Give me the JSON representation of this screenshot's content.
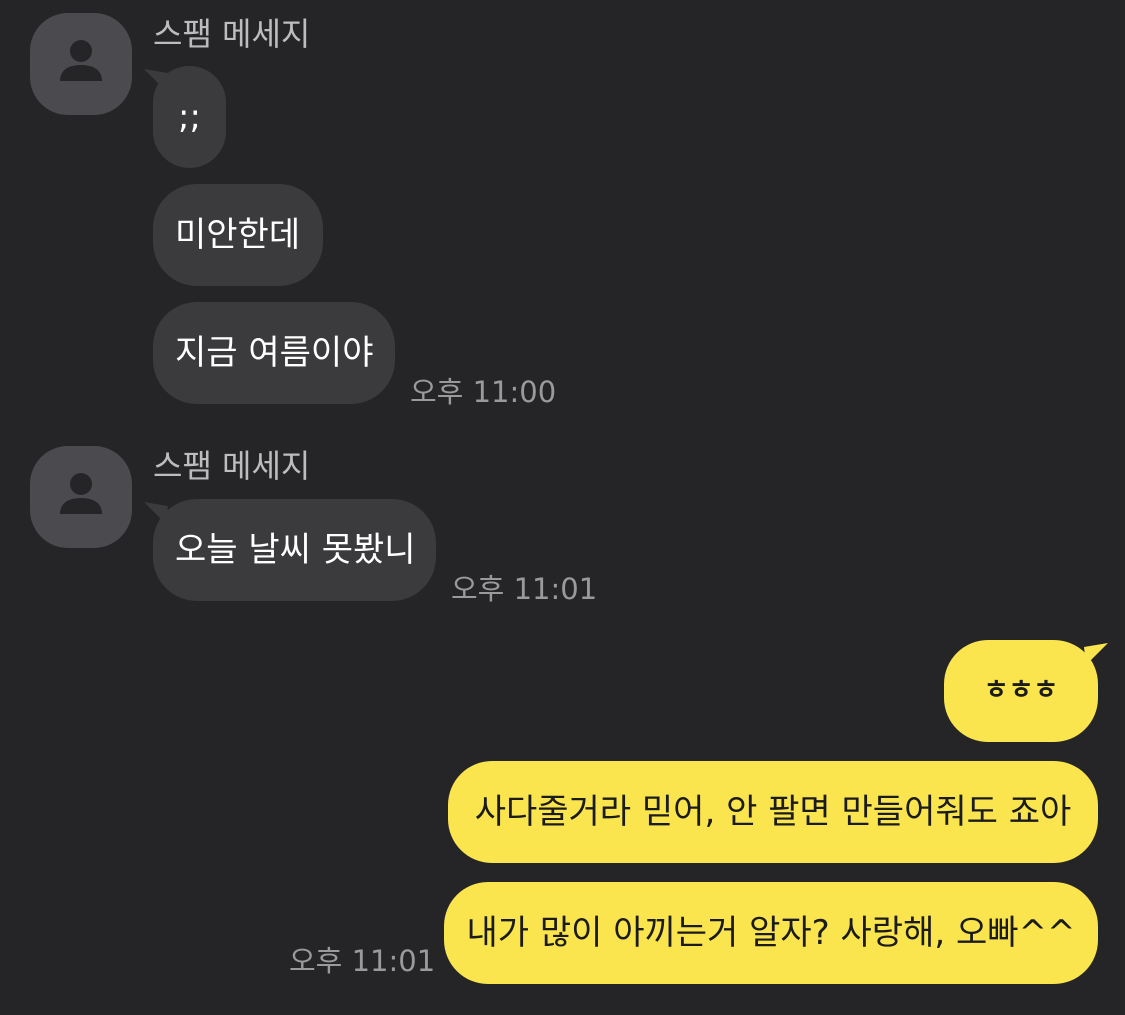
{
  "incoming_groups": [
    {
      "sender": "스팸 메세지",
      "avatar_icon": "person-icon",
      "messages": [
        ";;",
        "미안한데",
        "지금 여름이야"
      ],
      "time": "오후 11:00"
    },
    {
      "sender": "스팸 메세지",
      "avatar_icon": "person-icon",
      "messages": [
        "오늘 날씨 못봤니"
      ],
      "time": "오후 11:01"
    }
  ],
  "outgoing_group": {
    "messages": [
      "ㅎㅎㅎ",
      "사다줄거라 믿어, 안 팔면 만들어줘도 죠아",
      "내가 많이 아끼는거 알자? 사랑해, 오빠^^"
    ],
    "time": "오후 11:01"
  },
  "colors": {
    "background": "#252528",
    "incoming_bubble": "#3b3b3e",
    "outgoing_bubble": "#fae54e",
    "avatar": "#4a4a4f"
  }
}
